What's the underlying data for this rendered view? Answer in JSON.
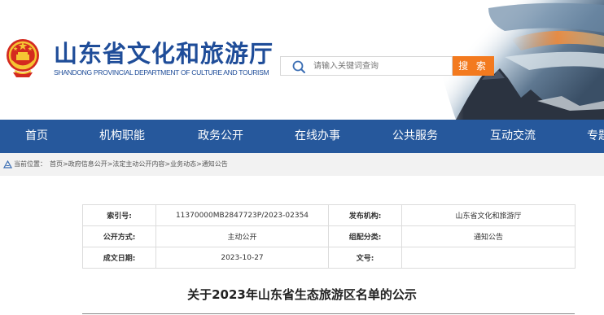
{
  "header": {
    "site_title": "山东省文化和旅游厅",
    "site_subtitle": "SHANDONG PROVINCIAL DEPARTMENT OF CULTURE AND TOURISM",
    "emblem_icon": "national-emblem-icon",
    "brand_color": "#1f4d99"
  },
  "search": {
    "placeholder": "请输入关键词查询",
    "button_label": "搜 索",
    "button_color": "#f37a1f",
    "icon": "search-icon"
  },
  "nav": {
    "background": "#26589c",
    "items": [
      {
        "label": "首页"
      },
      {
        "label": "机构职能"
      },
      {
        "label": "政务公开"
      },
      {
        "label": "在线办事"
      },
      {
        "label": "公共服务"
      },
      {
        "label": "互动交流"
      },
      {
        "label": "专题"
      }
    ]
  },
  "breadcrumb": {
    "prefix": "当前位置：",
    "path": "首页>政府信息公开>法定主动公开内容>业务动态>通知公告",
    "icon": "location-icon"
  },
  "meta_table": {
    "rows": [
      {
        "k1": "索引号:",
        "v1": "11370000MB2847723P/2023-02354",
        "k2": "发布机构:",
        "v2": "山东省文化和旅游厅"
      },
      {
        "k1": "公开方式:",
        "v1": "主动公开",
        "k2": "组配分类:",
        "v2": "通知公告"
      },
      {
        "k1": "成文日期:",
        "v1": "2023-10-27",
        "k2": "文号:",
        "v2": ""
      }
    ]
  },
  "article": {
    "title": "关于2023年山东省生态旅游区名单的公示"
  }
}
